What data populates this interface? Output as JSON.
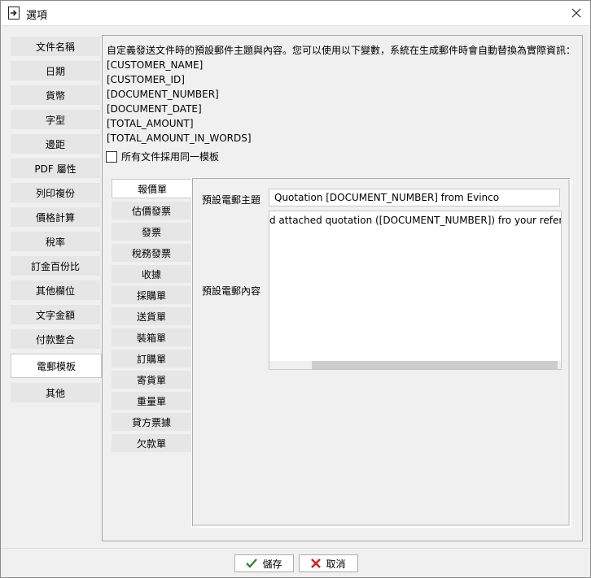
{
  "window": {
    "title": "選項"
  },
  "nav": {
    "items": [
      {
        "label": "文件名稱"
      },
      {
        "label": "日期"
      },
      {
        "label": "貨幣"
      },
      {
        "label": "字型"
      },
      {
        "label": "邊距"
      },
      {
        "label": "PDF 屬性"
      },
      {
        "label": "列印複份"
      },
      {
        "label": "價格計算"
      },
      {
        "label": "稅率"
      },
      {
        "label": "訂金百份比"
      },
      {
        "label": "其他欄位"
      },
      {
        "label": "文字金額"
      },
      {
        "label": "付款整合"
      },
      {
        "label": "電郵模板"
      },
      {
        "label": "其他"
      }
    ],
    "active_index": 13
  },
  "content": {
    "description": "自定義發送文件時的預設郵件主題與內容。您可以使用以下變數，系統在生成郵件時會自動替換為實際資訊：",
    "variables": [
      "[CUSTOMER_NAME]",
      "[CUSTOMER_ID]",
      "[DOCUMENT_NUMBER]",
      "[DOCUMENT_DATE]",
      "[TOTAL_AMOUNT]",
      "[TOTAL_AMOUNT_IN_WORDS]"
    ],
    "same_template_label": "所有文件採用同一模板",
    "same_template_checked": false
  },
  "doc_tabs": {
    "items": [
      {
        "label": "報價單"
      },
      {
        "label": "估價發票"
      },
      {
        "label": "發票"
      },
      {
        "label": "稅務發票"
      },
      {
        "label": "收據"
      },
      {
        "label": "採購單"
      },
      {
        "label": "送貨單"
      },
      {
        "label": "裝箱單"
      },
      {
        "label": "訂購單"
      },
      {
        "label": "寄貨單"
      },
      {
        "label": "重量單"
      },
      {
        "label": "貸方票據"
      },
      {
        "label": "欠款單"
      }
    ],
    "active_index": 0
  },
  "email": {
    "subject_label": "預設電郵主題",
    "subject_value": "Quotation [DOCUMENT_NUMBER] from Evinco",
    "body_label": "預設電郵內容",
    "body_value": "d attached quotation ([DOCUMENT_NUMBER]) fro your reference."
  },
  "footer": {
    "save_label": "儲存",
    "cancel_label": "取消"
  },
  "colors": {
    "save_icon": "#2e8b2e",
    "cancel_icon": "#d42020"
  }
}
